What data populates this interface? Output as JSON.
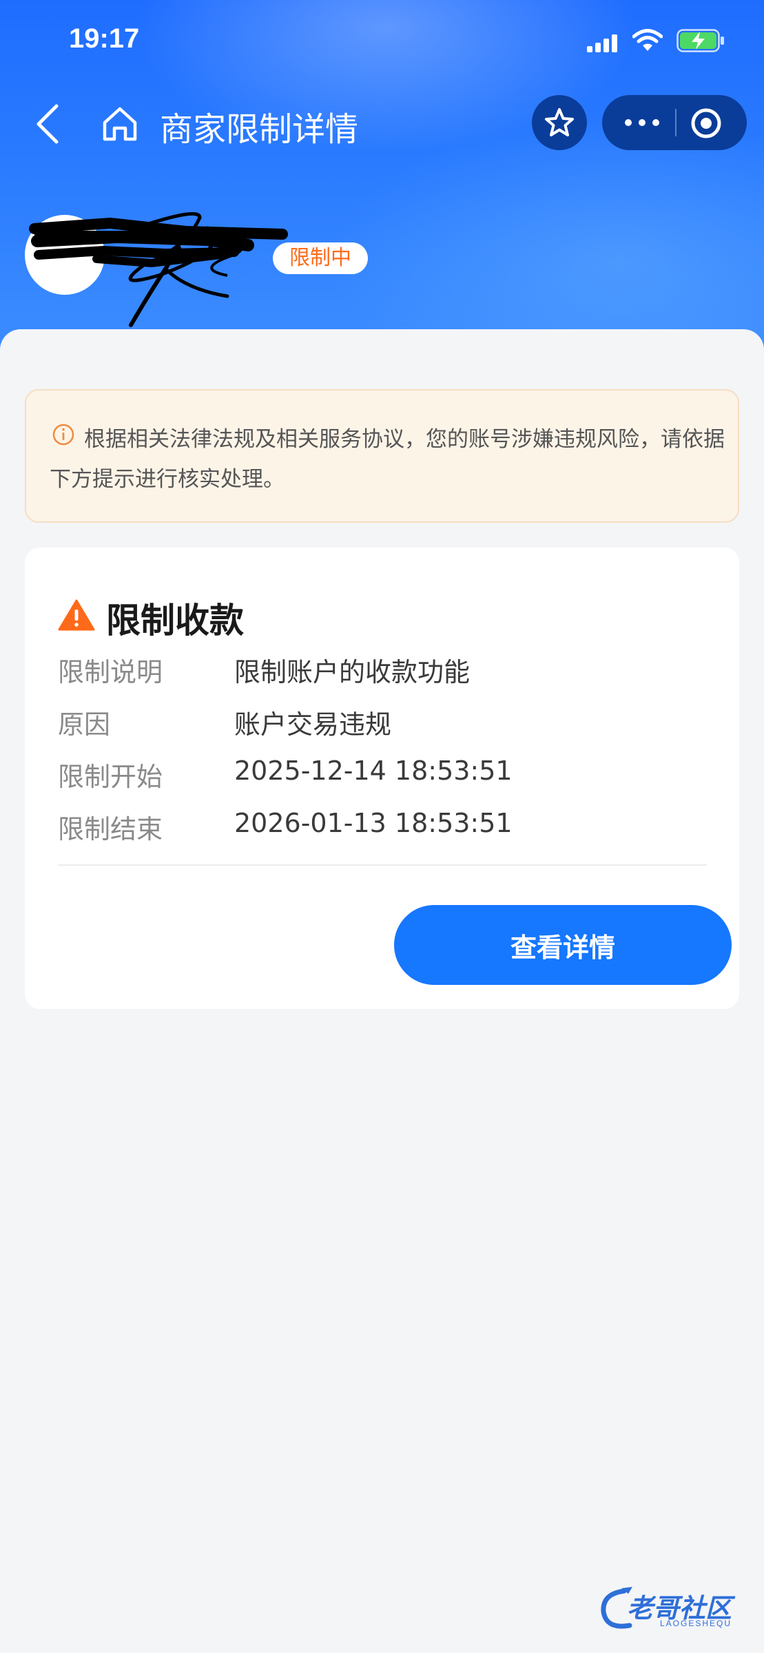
{
  "status_bar": {
    "time": "19:17",
    "signal_icon": "signal-bars-icon",
    "wifi_icon": "wifi-icon",
    "battery_icon": "battery-charging-icon",
    "battery_color": "#4cd964"
  },
  "nav": {
    "title": "商家限制详情",
    "back_icon": "chevron-left-icon",
    "home_icon": "home-icon",
    "favorite_icon": "star-icon",
    "more_icon": "more-dots-icon",
    "close_icon": "target-circle-icon"
  },
  "merchant": {
    "status_badge": "限制中",
    "badge_color": "#ff6a1a"
  },
  "notice": {
    "icon": "info-circle-icon",
    "text": "根据相关法律法规及相关服务协议，您的账号涉嫌违规风险，请依据下方提示进行核实处理。"
  },
  "restriction": {
    "title": "限制收款",
    "title_icon": "warning-triangle-icon",
    "rows": [
      {
        "label": "限制说明",
        "value": "限制账户的收款功能"
      },
      {
        "label": "原因",
        "value": "账户交易违规"
      },
      {
        "label": "限制开始",
        "value": "2025-12-14 18:53:51"
      },
      {
        "label": "限制结束",
        "value": "2026-01-13 18:53:51"
      }
    ],
    "button_label": "查看详情"
  },
  "watermark": {
    "text": "老哥社区",
    "sub": "LAOGESHEQU"
  },
  "colors": {
    "primary": "#1677ff",
    "header": "#2a7bff",
    "warning": "#ff6a1a"
  }
}
